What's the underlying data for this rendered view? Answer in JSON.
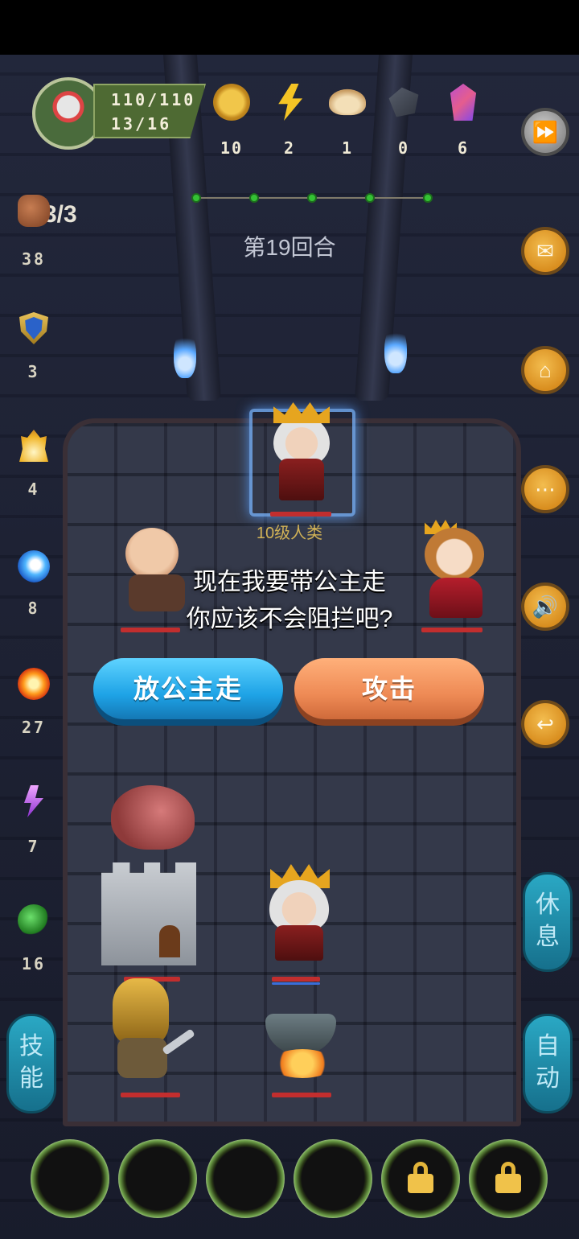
{
  "player": {
    "hp": "110/110",
    "mp": "13/16"
  },
  "resources": [
    {
      "icon": "gold-coin-icon",
      "count": "10"
    },
    {
      "icon": "lightning-icon",
      "count": "2"
    },
    {
      "icon": "dumpling-icon",
      "count": "1"
    },
    {
      "icon": "iron-ore-icon",
      "count": "0"
    },
    {
      "icon": "crystal-icon",
      "count": "6"
    }
  ],
  "round": {
    "label": "第19回合",
    "progress_dots": 5
  },
  "attack_count": "3/3",
  "stats": [
    {
      "icon": "fist-icon",
      "value": "38"
    },
    {
      "icon": "shield-icon",
      "value": "3"
    },
    {
      "icon": "golden-flame-icon",
      "value": "4"
    },
    {
      "icon": "water-wave-icon",
      "value": "8"
    },
    {
      "icon": "fireball-icon",
      "value": "27"
    },
    {
      "icon": "purple-lightning-icon",
      "value": "7"
    },
    {
      "icon": "green-slime-icon",
      "value": "16"
    }
  ],
  "target": {
    "level_label": "10级人类"
  },
  "dialog": {
    "line1": "现在我要带公主走",
    "line2": "你应该不会阻拦吧?",
    "choice_release": "放公主走",
    "choice_attack": "攻击"
  },
  "side_buttons": {
    "rest": [
      "休",
      "息"
    ],
    "skill": [
      "技",
      "能"
    ],
    "auto": [
      "自",
      "动"
    ]
  },
  "colors": {
    "release_button": "#1ea3e6",
    "attack_button": "#ee8a55",
    "menu_button": "#d98e1f",
    "side_pill": "#16708c"
  },
  "bottom_slots": [
    {
      "locked": false
    },
    {
      "locked": false
    },
    {
      "locked": false
    },
    {
      "locked": false
    },
    {
      "locked": true
    },
    {
      "locked": true
    }
  ]
}
